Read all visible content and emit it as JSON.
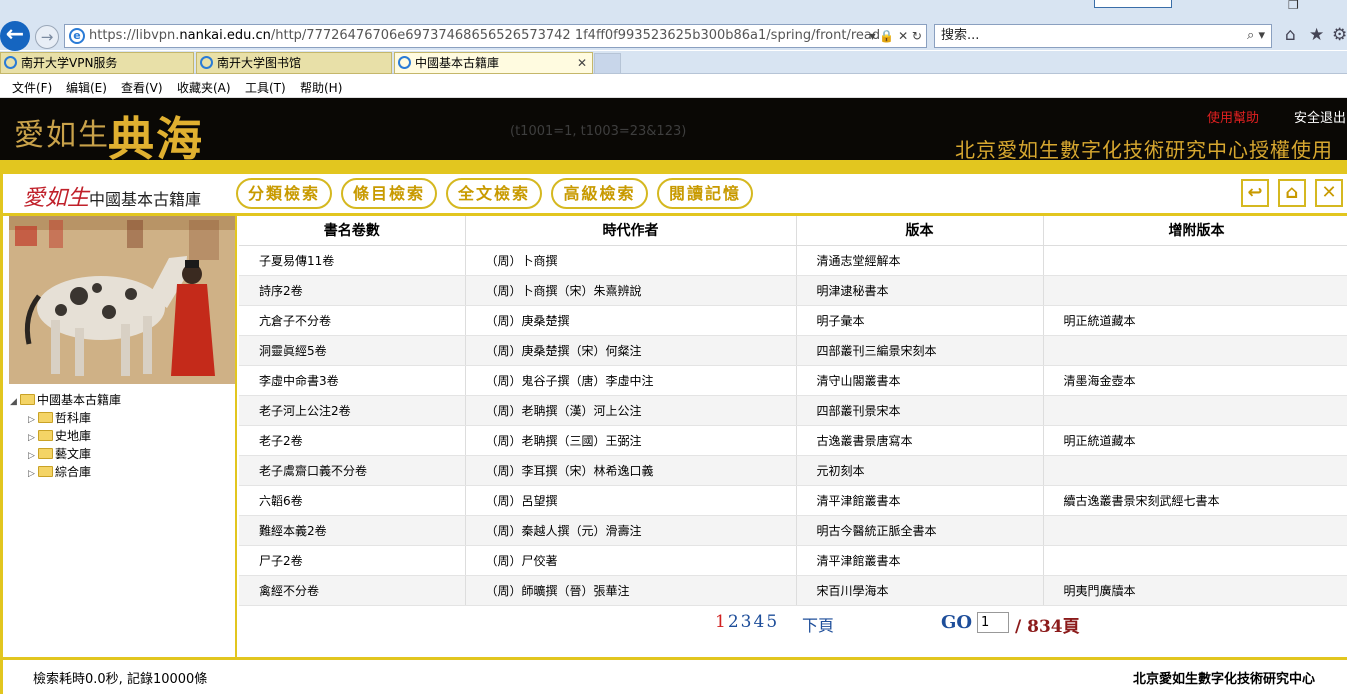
{
  "browser": {
    "url_prefix": "https://libvpn.",
    "url_domain": "nankai.edu.cn",
    "url_path": "/http/77726476706e697374686562657374 21f4ff0f993523625b300b86a1/spring/front/read",
    "search_placeholder": "搜索...",
    "tabs": [
      {
        "label": "南开大学VPN服务"
      },
      {
        "label": "南开大学图书馆"
      },
      {
        "label": "中國基本古籍庫"
      }
    ],
    "menu": [
      "文件(F)",
      "编辑(E)",
      "查看(V)",
      "收藏夹(A)",
      "工具(T)",
      "帮助(H)"
    ]
  },
  "header": {
    "logo_script": "愛如生",
    "logo_big": "典海",
    "params": "(t1001=1, t1003=23&123)",
    "help": "使用幫助",
    "logout": "安全退出",
    "authorization": "北京愛如生數字化技術研究中心授權使用"
  },
  "nav": {
    "brand_script": "愛如生",
    "brand_name": "中國基本古籍庫",
    "buttons": [
      "分類檢索",
      "條目檢索",
      "全文檢索",
      "高級檢索",
      "閱讀記憶"
    ]
  },
  "tree": {
    "root": "中國基本古籍庫",
    "children": [
      "哲科庫",
      "史地庫",
      "藝文庫",
      "綜合庫"
    ]
  },
  "table": {
    "headers": [
      "書名卷數",
      "時代作者",
      "版本",
      "增附版本"
    ],
    "rows": [
      [
        "子夏易傳11卷",
        "（周）卜商撰",
        "清通志堂經解本",
        ""
      ],
      [
        "詩序2卷",
        "（周）卜商撰（宋）朱熹辨說",
        "明津逮秘書本",
        ""
      ],
      [
        "亢倉子不分卷",
        "（周）庚桑楚撰",
        "明子彙本",
        "明正統道藏本"
      ],
      [
        "洞靈眞經5卷",
        "（周）庚桑楚撰（宋）何粲注",
        "四部叢刊三編景宋刻本",
        ""
      ],
      [
        "李虛中命書3卷",
        "（周）鬼谷子撰（唐）李虛中注",
        "清守山閣叢書本",
        "清墨海金壺本"
      ],
      [
        "老子河上公注2卷",
        "（周）老聃撰（漢）河上公注",
        "四部叢刊景宋本",
        ""
      ],
      [
        "老子2卷",
        "（周）老聃撰（三國）王弼注",
        "古逸叢書景唐寫本",
        "明正統道藏本"
      ],
      [
        "老子鬳齋口義不分卷",
        "（周）李耳撰（宋）林希逸口義",
        "元初刻本",
        ""
      ],
      [
        "六韜6卷",
        "（周）呂望撰",
        "清平津館叢書本",
        "續古逸叢書景宋刻武經七書本"
      ],
      [
        "難經本義2卷",
        "（周）秦越人撰（元）滑壽注",
        "明古今醫統正脈全書本",
        ""
      ],
      [
        "尸子2卷",
        "（周）尸佼著",
        "清平津館叢書本",
        ""
      ],
      [
        "禽經不分卷",
        "（周）師曠撰（晉）張華注",
        "宋百川學海本",
        "明夷門廣牘本"
      ]
    ]
  },
  "pager": {
    "pages": [
      "1",
      "2",
      "3",
      "4",
      "5"
    ],
    "next": "下頁",
    "go": "GO",
    "current": "1",
    "total": "/ 834頁"
  },
  "footer": {
    "status": "檢索耗時0.0秒, 記錄10000條",
    "org": "北京愛如生數字化技術研究中心"
  },
  "colors": {
    "gold": "#e2c61f",
    "header_bg": "#0a0805",
    "link_blue": "#1e4e9a",
    "current_red": "#d02020"
  }
}
